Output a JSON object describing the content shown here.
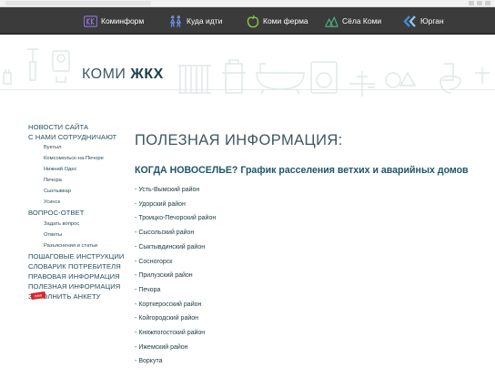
{
  "nav": {
    "items": [
      {
        "label": "Коминформ",
        "icon": "kominform-logo-icon"
      },
      {
        "label": "Куда идти",
        "icon": "people-icon"
      },
      {
        "label": "Коми ферма",
        "icon": "apple-icon"
      },
      {
        "label": "Сёла Коми",
        "icon": "village-icon"
      },
      {
        "label": "Юрган",
        "icon": "arrows-icon"
      }
    ]
  },
  "banner": {
    "logo_light": "КОМИ ",
    "logo_bold": "ЖКХ"
  },
  "sidebar": {
    "items": [
      {
        "label": "НОВОСТИ САЙТА",
        "level": 0
      },
      {
        "label": "С НАМИ СОТРУДНИЧАЮТ",
        "level": 0
      },
      {
        "label": "Вуктыл",
        "level": 1
      },
      {
        "label": "Комсомольск-на-Печоре",
        "level": 1
      },
      {
        "label": "Нижний Одес",
        "level": 1
      },
      {
        "label": "Печора",
        "level": 1
      },
      {
        "label": "Сыктывкар",
        "level": 1
      },
      {
        "label": "Усинск",
        "level": 1
      },
      {
        "label": "ВОПРОС-ОТВЕТ",
        "level": 0
      },
      {
        "label": "Задать вопрос",
        "level": 1
      },
      {
        "label": "Ответы",
        "level": 1
      },
      {
        "label": "Разъяснения и статьи",
        "level": 1
      },
      {
        "label": "ПОШАГОВЫЕ ИНСТРУКЦИИ",
        "level": 0
      },
      {
        "label": "СЛОВАРИК ПОТРЕБИТЕЛЯ",
        "level": 0
      },
      {
        "label": "ПРАВОВАЯ ИНФОРМАЦИЯ",
        "level": 0
      },
      {
        "label": "ПОЛЕЗНАЯ ИНФОРМАЦИЯ",
        "level": 0
      },
      {
        "label": "ЗАПОЛНИТЬ АНКЕТУ",
        "level": 0
      }
    ],
    "new_badge": "new"
  },
  "content": {
    "title": "ПОЛЕЗНАЯ ИНФОРМАЦИЯ:",
    "section_title": "КОГДА НОВОСЕЛЬЕ? График расселения ветхих и аварийных домов",
    "districts": [
      "Усть-Вымский район",
      "Удорский район",
      "Троицко-Печорский район",
      "Сысольский район",
      "Сыктывдинский район",
      "Сосногорск",
      "Прилузский район",
      "Печора",
      "Корткеросский район",
      "Койгородский район",
      "Княжпогостский район",
      "Ижемский район",
      "Воркута"
    ]
  },
  "colors": {
    "nav_bg": "#3b3b3b",
    "link": "#24505f",
    "heading": "#3f5660",
    "accent": "#1f5569",
    "badge": "#d9262c"
  }
}
